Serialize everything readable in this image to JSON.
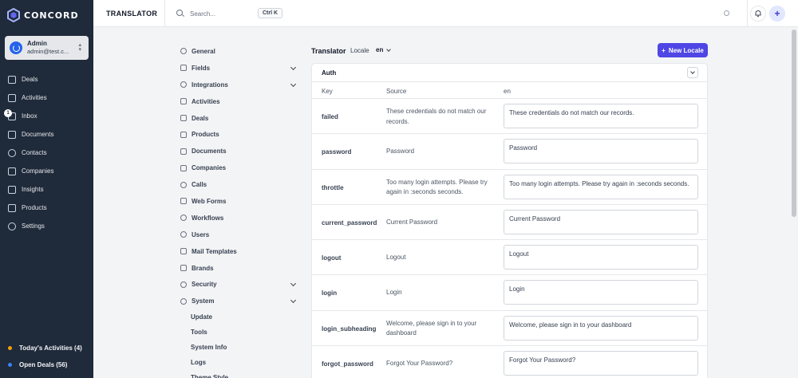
{
  "app": {
    "brand": "CONCORD"
  },
  "user": {
    "name": "Admin",
    "email": "admin@test.c..."
  },
  "sidebar": {
    "items": [
      {
        "label": "Deals",
        "icon": "deals-icon"
      },
      {
        "label": "Activities",
        "icon": "calendar-icon"
      },
      {
        "label": "Inbox",
        "icon": "inbox-icon",
        "badge": "1"
      },
      {
        "label": "Documents",
        "icon": "document-icon"
      },
      {
        "label": "Contacts",
        "icon": "contacts-icon"
      },
      {
        "label": "Companies",
        "icon": "building-icon"
      },
      {
        "label": "Insights",
        "icon": "insights-icon"
      },
      {
        "label": "Products",
        "icon": "products-icon"
      },
      {
        "label": "Settings",
        "icon": "gear-icon"
      }
    ],
    "bottom": [
      {
        "label": "Today's Activities (4)",
        "color": "#f59e0b"
      },
      {
        "label": "Open Deals (56)",
        "color": "#3b82f6"
      }
    ]
  },
  "topbar": {
    "title": "TRANSLATOR",
    "search_placeholder": "Search...",
    "shortcut": "Ctrl K"
  },
  "settings_menu": {
    "items": [
      {
        "label": "General",
        "icon": "gear-icon",
        "expandable": false
      },
      {
        "label": "Fields",
        "icon": "fields-icon",
        "expandable": true
      },
      {
        "label": "Integrations",
        "icon": "globe-icon",
        "expandable": true
      },
      {
        "label": "Activities",
        "icon": "calendar-icon",
        "expandable": false
      },
      {
        "label": "Deals",
        "icon": "deals-icon",
        "expandable": false
      },
      {
        "label": "Products",
        "icon": "products-icon",
        "expandable": false
      },
      {
        "label": "Documents",
        "icon": "document-icon",
        "expandable": false
      },
      {
        "label": "Companies",
        "icon": "building-icon",
        "expandable": false
      },
      {
        "label": "Calls",
        "icon": "phone-icon",
        "expandable": false
      },
      {
        "label": "Web Forms",
        "icon": "webforms-icon",
        "expandable": false
      },
      {
        "label": "Workflows",
        "icon": "rocket-icon",
        "expandable": false
      },
      {
        "label": "Users",
        "icon": "users-icon",
        "expandable": false
      },
      {
        "label": "Mail Templates",
        "icon": "mail-icon",
        "expandable": false
      },
      {
        "label": "Brands",
        "icon": "brands-icon",
        "expandable": false
      },
      {
        "label": "Security",
        "icon": "shield-icon",
        "expandable": true
      },
      {
        "label": "System",
        "icon": "gear-icon",
        "expandable": true
      }
    ],
    "system_sub": [
      "Update",
      "Tools",
      "System Info",
      "Logs",
      "Theme Style"
    ]
  },
  "translator": {
    "title": "Translator",
    "locale_label": "Locale",
    "locale_value": "en",
    "new_locale_label": "New Locale",
    "group": "Auth",
    "columns": {
      "key": "Key",
      "source": "Source",
      "locale": "en"
    },
    "rows": [
      {
        "key": "failed",
        "source": "These credentials do not match our records.",
        "value": "These credentials do not match our records."
      },
      {
        "key": "password",
        "source": "Password",
        "value": "Password"
      },
      {
        "key": "throttle",
        "source": "Too many login attempts. Please try again in :seconds seconds.",
        "value": "Too many login attempts. Please try again in :seconds seconds."
      },
      {
        "key": "current_password",
        "source": "Current Password",
        "value": "Current Password"
      },
      {
        "key": "logout",
        "source": "Logout",
        "value": "Logout"
      },
      {
        "key": "login",
        "source": "Login",
        "value": "Login"
      },
      {
        "key": "login_subheading",
        "source": "Welcome, please sign in to your dashboard",
        "value": "Welcome, please sign in to your dashboard"
      },
      {
        "key": "forgot_password",
        "source": "Forgot Your Password?",
        "value": "Forgot Your Password?"
      }
    ]
  },
  "colors": {
    "sidebar_bg": "#1f2a3a",
    "accent": "#4f46e5",
    "page_bg": "#f3f4f6"
  }
}
